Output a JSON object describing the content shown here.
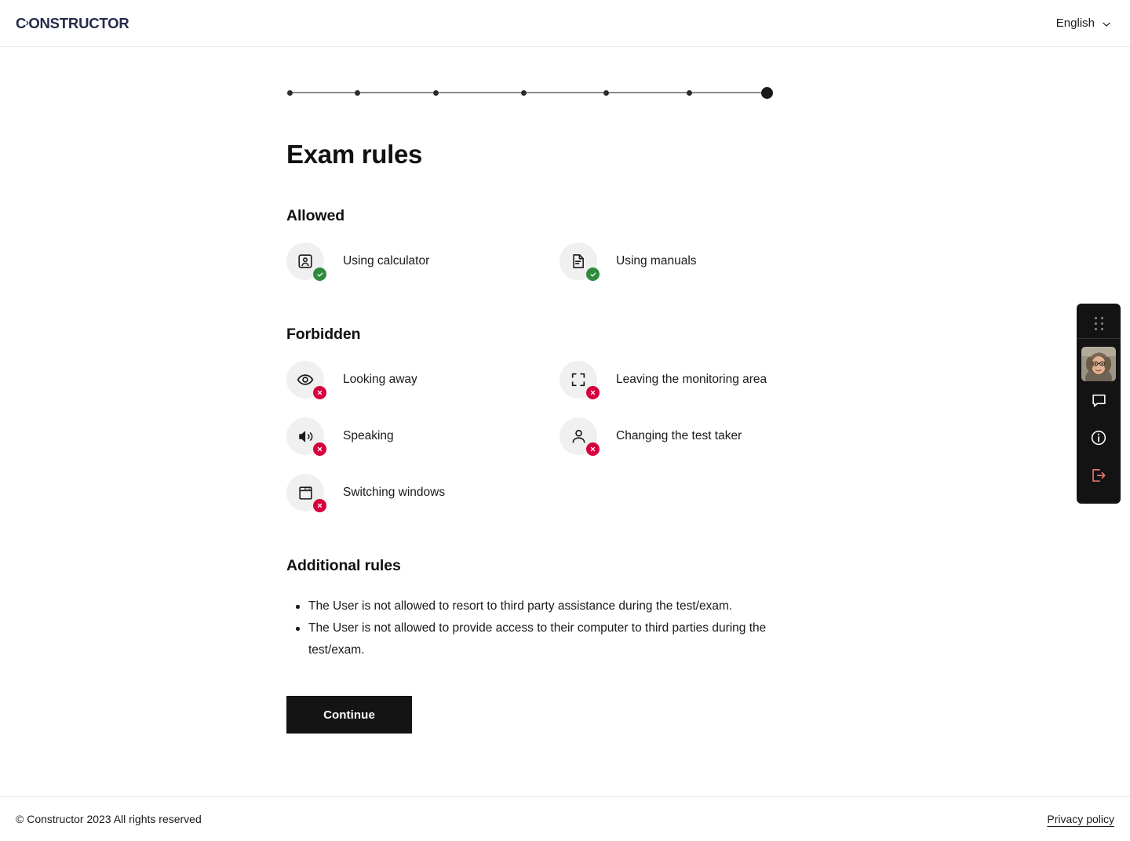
{
  "header": {
    "logo_text_a": "C",
    "logo_chevron": "›",
    "logo_text_b": "ONSTRUCTOR",
    "language_label": "English",
    "caret_icon": "chevron-down-icon"
  },
  "stepper": {
    "total_steps": 7,
    "active_step": 7
  },
  "main": {
    "page_title": "Exam rules",
    "allowed_heading": "Allowed",
    "forbidden_heading": "Forbidden",
    "additional_heading": "Additional rules"
  },
  "allowed": [
    {
      "label": "Using calculator",
      "icon": "id-badge-icon",
      "badge": "check-badge-icon"
    },
    {
      "label": "Using manuals",
      "icon": "document-icon",
      "badge": "check-badge-icon"
    }
  ],
  "forbidden": [
    {
      "label": "Looking away",
      "icon": "eye-icon",
      "badge": "cross-badge-icon"
    },
    {
      "label": "Leaving the monitoring area",
      "icon": "frame-corners-icon",
      "badge": "cross-badge-icon"
    },
    {
      "label": "Speaking",
      "icon": "speaker-icon",
      "badge": "cross-badge-icon"
    },
    {
      "label": "Changing the test taker",
      "icon": "person-icon",
      "badge": "cross-badge-icon"
    },
    {
      "label": "Switching windows",
      "icon": "window-icon",
      "badge": "cross-badge-icon"
    }
  ],
  "additional_rules": [
    "The User is not allowed to resort to third party assistance during the test/exam.",
    "The User is not allowed to provide access to their computer to third parties during the test/exam."
  ],
  "actions": {
    "continue_label": "Continue"
  },
  "proctor_panel": {
    "drag_handle_icon": "drag-dots-icon",
    "webcam_icon": "webcam-thumbnail",
    "chat_icon": "chat-bubble-icon",
    "info_icon": "info-circle-icon",
    "exit_icon": "exit-icon",
    "exit_color": "#e8766b",
    "background": "#131313"
  },
  "footer": {
    "copyright": "© Constructor 2023 All rights reserved",
    "privacy_label": "Privacy policy"
  },
  "colors": {
    "allowed_badge": "#2e8b3d",
    "forbidden_badge": "#d6003c",
    "brand_navy": "#262b49",
    "button_bg": "#141414"
  }
}
